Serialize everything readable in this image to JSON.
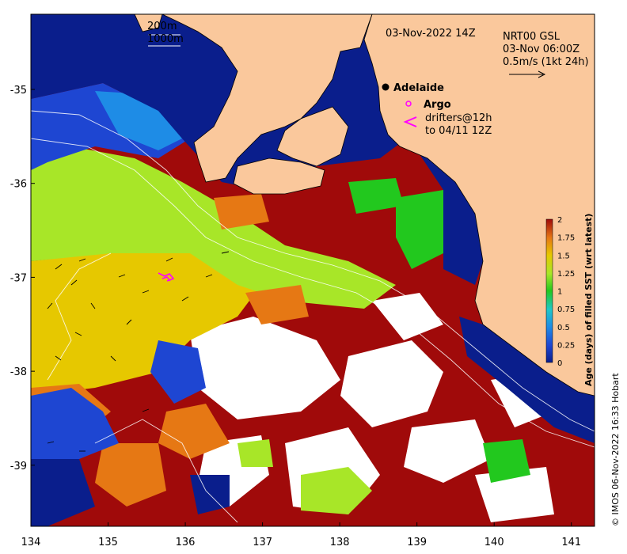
{
  "map": {
    "date_label": "03-Nov-2022 14Z",
    "product_lines": [
      "NRT00 GSL",
      "03-Nov 06:00Z",
      "0.5m/s (1kt 24h)"
    ],
    "isobath_labels": [
      "200m",
      "1000m"
    ],
    "places": [
      {
        "name": "Adelaide",
        "lon": 138.6,
        "lat": -34.93
      }
    ],
    "legend": {
      "argo_label": "Argo",
      "drifter_lines": [
        "drifters@12h",
        "to 04/11 12Z"
      ]
    },
    "x_axis": {
      "ticks": [
        134,
        135,
        136,
        137,
        138,
        139,
        140,
        141
      ],
      "range": [
        134,
        141.3
      ]
    },
    "y_axis": {
      "ticks": [
        -35,
        -36,
        -37,
        -38,
        -39
      ],
      "range": [
        -39.65,
        -34.2
      ]
    },
    "colorbar": {
      "title": "Age (days) of filled SST (wrt latest)",
      "ticks": [
        "0",
        "0.25",
        "0.5",
        "0.75",
        "1",
        "1.25",
        "1.5",
        "1.75",
        "2"
      ],
      "range": [
        0,
        2
      ]
    },
    "credit": "© IMOS 06-Nov-2022 16:33 Hobart",
    "colors": {
      "land": "#fac89c",
      "ocean_fresh": "#0a1e8c",
      "age_mid_green": "#22c81e",
      "age_yellow": "#e6c800",
      "age_old": "#a00a0a",
      "missing": "#ffffff",
      "argo": "#ff00ff",
      "drifter": "#ff00ff"
    }
  }
}
